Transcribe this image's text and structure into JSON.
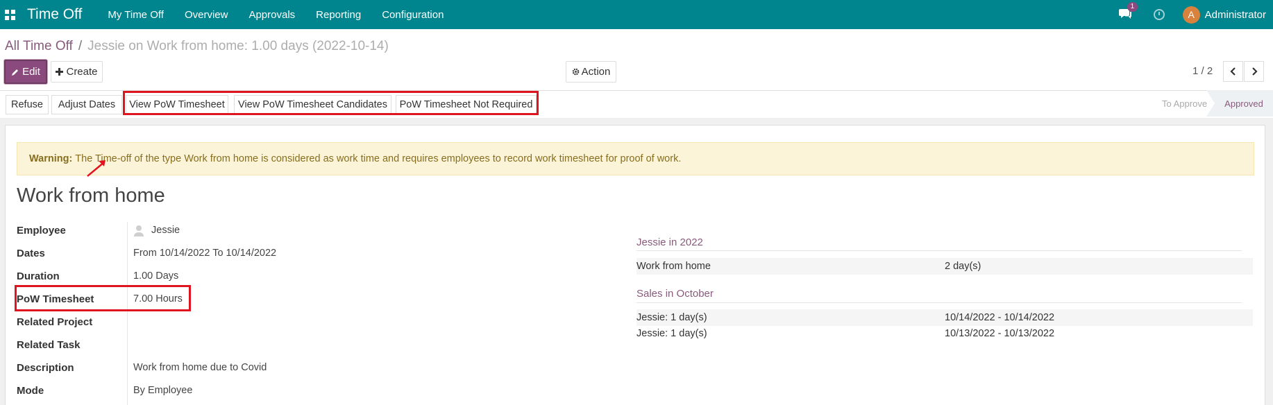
{
  "navbar": {
    "app_name": "Time Off",
    "menu": [
      "My Time Off",
      "Overview",
      "Approvals",
      "Reporting",
      "Configuration"
    ],
    "chat_count": "1",
    "user_initial": "A",
    "user_name": "Administrator",
    "bg_color": "#00848d"
  },
  "breadcrumb": {
    "root": "All Time Off",
    "separator": "/",
    "current": "Jessie on Work from home: 1.00 days (2022-10-14)"
  },
  "controls": {
    "edit_label": "Edit",
    "create_label": "Create",
    "action_label": "Action",
    "pager": "1 / 2"
  },
  "statusbar": {
    "buttons": [
      "Refuse",
      "Adjust Dates",
      "View PoW Timesheet",
      "View PoW Timesheet Candidates",
      "PoW Timesheet Not Required"
    ],
    "stages": [
      "To Approve",
      "Approved"
    ],
    "active_stage": "Approved"
  },
  "warning": {
    "prefix": "Warning:",
    "text": "The Time-off of the type Work from home is considered as work time and requires employees to record work timesheet for proof of work."
  },
  "form": {
    "title": "Work from home",
    "fields": [
      {
        "label": "Employee",
        "value": "Jessie"
      },
      {
        "label": "Dates",
        "value": "From 10/14/2022  To 10/14/2022"
      },
      {
        "label": "Duration",
        "value": "1.00  Days"
      },
      {
        "label": "PoW Timesheet",
        "value": "7.00  Hours"
      },
      {
        "label": "Related Project",
        "value": ""
      },
      {
        "label": "Related Task",
        "value": ""
      },
      {
        "label": "Description",
        "value": "Work from home due to Covid"
      },
      {
        "label": "Mode",
        "value": "By Employee"
      }
    ]
  },
  "side": {
    "section1": {
      "title": "Jessie in 2022",
      "rows": [
        {
          "name": "Work from home",
          "value": "2 day(s)"
        }
      ]
    },
    "section2": {
      "title": "Sales in October",
      "rows": [
        {
          "name": "Jessie: 1 day(s)",
          "value": "10/14/2022 - 10/14/2022"
        },
        {
          "name": "Jessie: 1 day(s)",
          "value": "10/13/2022 - 10/13/2022"
        }
      ]
    }
  },
  "accent_colors": {
    "primary": "#875a7b",
    "highlight_box": "#e0141e"
  }
}
